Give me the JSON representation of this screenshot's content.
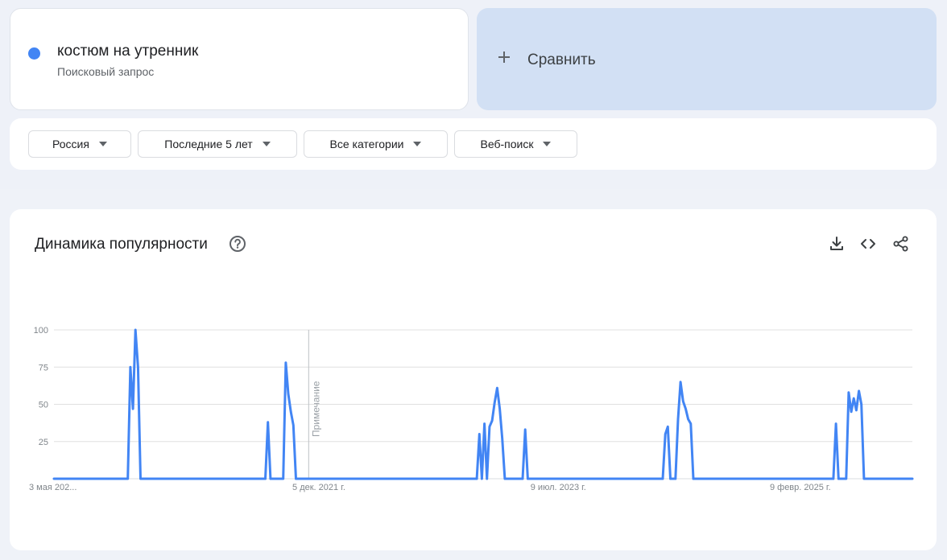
{
  "search_term": {
    "title": "костюм на утренник",
    "subtitle": "Поисковый запрос",
    "color": "#4285f4"
  },
  "compare": {
    "icon": "plus-icon",
    "label": "Сравнить"
  },
  "filters": {
    "region": "Россия",
    "period": "Последние 5 лет",
    "category": "Все категории",
    "search_type": "Веб-поиск"
  },
  "chart_panel": {
    "title": "Динамика популярности",
    "help_icon": "help-circle-icon",
    "download_icon": "download-icon",
    "embed_icon": "code-icon",
    "share_icon": "share-icon"
  },
  "chart_data": {
    "type": "line",
    "x_tick_labels": [
      "3 мая 202...",
      "5 дек. 2021 г.",
      "9 июл. 2023 г.",
      "9 февр. 2025 г."
    ],
    "y_ticks": [
      25,
      50,
      75,
      100
    ],
    "ylim": [
      0,
      100
    ],
    "grid": true,
    "annotation": "Примечание",
    "line_color": "#4285f4",
    "series": [
      {
        "values": [
          0,
          0,
          0,
          0,
          0,
          0,
          0,
          0,
          0,
          0,
          0,
          0,
          0,
          0,
          0,
          0,
          0,
          0,
          0,
          0,
          0,
          0,
          0,
          0,
          0,
          0,
          0,
          0,
          0,
          0,
          75,
          47,
          100,
          75,
          0,
          0,
          0,
          0,
          0,
          0,
          0,
          0,
          0,
          0,
          0,
          0,
          0,
          0,
          0,
          0,
          0,
          0,
          0,
          0,
          0,
          0,
          0,
          0,
          0,
          0,
          0,
          0,
          0,
          0,
          0,
          0,
          0,
          0,
          0,
          0,
          0,
          0,
          0,
          0,
          0,
          0,
          0,
          0,
          0,
          0,
          0,
          0,
          0,
          0,
          38,
          0,
          0,
          0,
          0,
          0,
          0,
          78,
          57,
          45,
          36,
          0,
          0,
          0,
          0,
          0,
          0,
          0,
          0,
          0,
          0,
          0,
          0,
          0,
          0,
          0,
          0,
          0,
          0,
          0,
          0,
          0,
          0,
          0,
          0,
          0,
          0,
          0,
          0,
          0,
          0,
          0,
          0,
          0,
          0,
          0,
          0,
          0,
          0,
          0,
          0,
          0,
          0,
          0,
          0,
          0,
          0,
          0,
          0,
          0,
          0,
          0,
          0,
          0,
          0,
          0,
          0,
          0,
          0,
          0,
          0,
          0,
          0,
          0,
          0,
          0,
          0,
          0,
          0,
          0,
          0,
          0,
          0,
          30,
          0,
          37,
          0,
          35,
          39,
          51,
          61,
          47,
          27,
          0,
          0,
          0,
          0,
          0,
          0,
          0,
          0,
          33,
          0,
          0,
          0,
          0,
          0,
          0,
          0,
          0,
          0,
          0,
          0,
          0,
          0,
          0,
          0,
          0,
          0,
          0,
          0,
          0,
          0,
          0,
          0,
          0,
          0,
          0,
          0,
          0,
          0,
          0,
          0,
          0,
          0,
          0,
          0,
          0,
          0,
          0,
          0,
          0,
          0,
          0,
          0,
          0,
          0,
          0,
          0,
          0,
          0,
          0,
          0,
          0,
          0,
          0,
          30,
          35,
          0,
          0,
          0,
          40,
          65,
          52,
          47,
          40,
          37,
          0,
          0,
          0,
          0,
          0,
          0,
          0,
          0,
          0,
          0,
          0,
          0,
          0,
          0,
          0,
          0,
          0,
          0,
          0,
          0,
          0,
          0,
          0,
          0,
          0,
          0,
          0,
          0,
          0,
          0,
          0,
          0,
          0,
          0,
          0,
          0,
          0,
          0,
          0,
          0,
          0,
          0,
          0,
          0,
          0,
          0,
          0,
          0,
          0,
          0,
          0,
          0,
          0,
          0,
          0,
          0,
          37,
          0,
          0,
          0,
          0,
          58,
          45,
          54,
          46,
          59,
          50,
          0,
          0,
          0,
          0,
          0,
          0,
          0,
          0,
          0,
          0,
          0,
          0,
          0,
          0,
          0,
          0,
          0,
          0,
          0,
          0
        ]
      }
    ]
  }
}
